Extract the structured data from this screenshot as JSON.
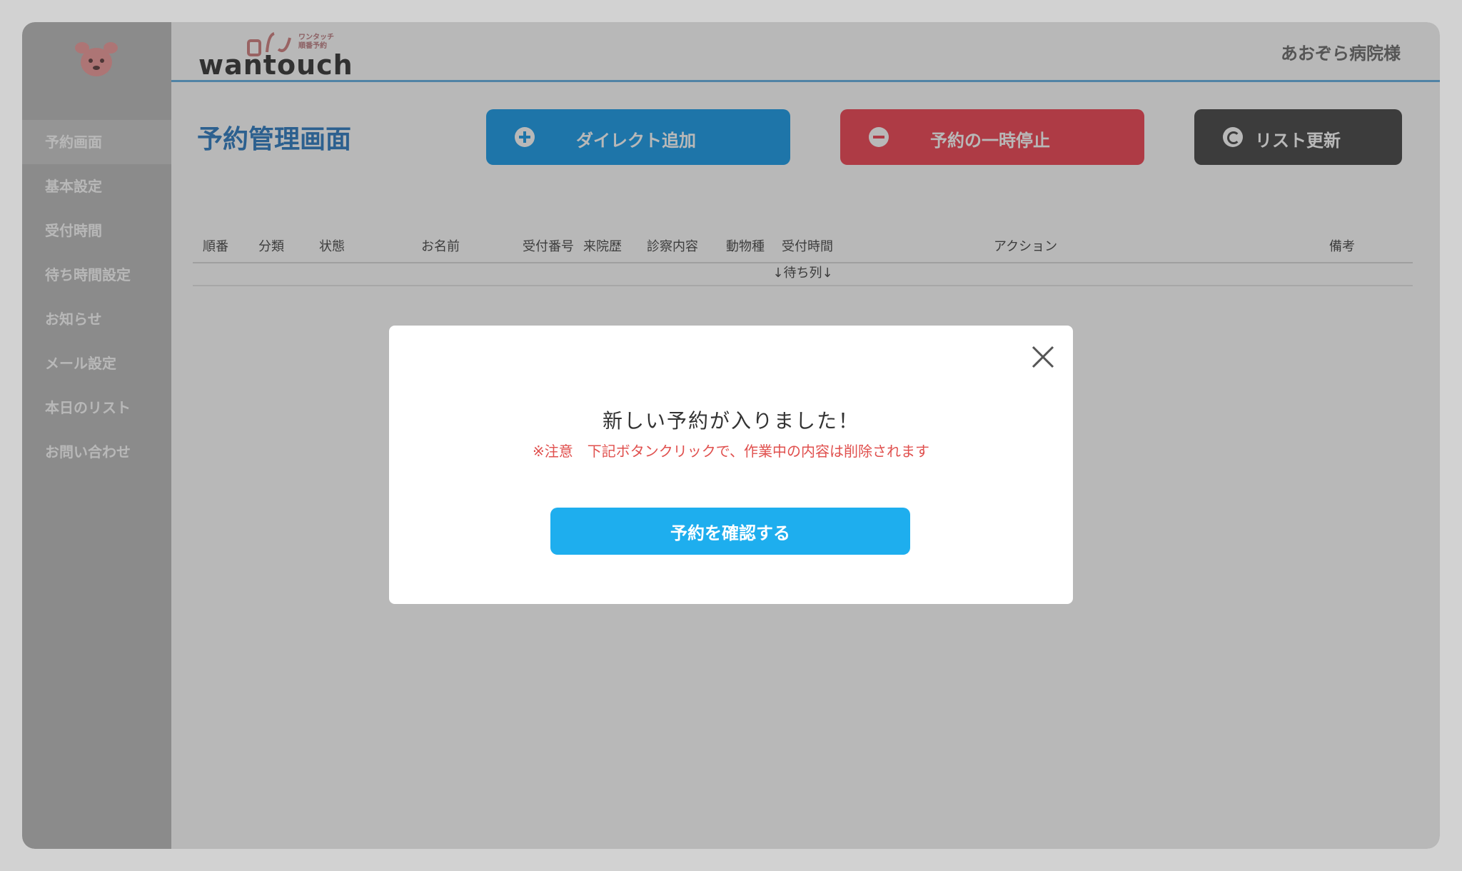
{
  "brand": {
    "small_text_1": "ワンタッチ",
    "small_text_2": "順番予約",
    "wordmark": "wantouch"
  },
  "header": {
    "hospital_name": "あおぞら病院様"
  },
  "sidebar": {
    "items": [
      {
        "label": "予約画面",
        "active": true
      },
      {
        "label": "基本設定"
      },
      {
        "label": "受付時間"
      },
      {
        "label": "待ち時間設定"
      },
      {
        "label": "お知らせ"
      },
      {
        "label": "メール設定"
      },
      {
        "label": "本日のリスト"
      },
      {
        "label": "お問い合わせ"
      }
    ]
  },
  "main": {
    "title": "予約管理画面",
    "buttons": {
      "direct_add": "ダイレクト追加",
      "pause": "予約の一時停止",
      "refresh": "リスト更新"
    },
    "table": {
      "columns": [
        "順番",
        "分類",
        "状態",
        "お名前",
        "受付番号",
        "来院歴",
        "診察内容",
        "動物種",
        "受付時間",
        "アクション",
        "備考"
      ],
      "queue_label": "↓待ち列↓"
    }
  },
  "modal": {
    "title": "新しい予約が入りました！",
    "note": "※注意　下記ボタンクリックで、作業中の内容は削除されます",
    "confirm_label": "予約を確認する"
  },
  "colors": {
    "primary": "#1eaeee",
    "danger": "#f25360",
    "title_blue": "#3d86c6",
    "sidebar_bg": "#c1c1c1",
    "note_red": "#e0504e"
  }
}
